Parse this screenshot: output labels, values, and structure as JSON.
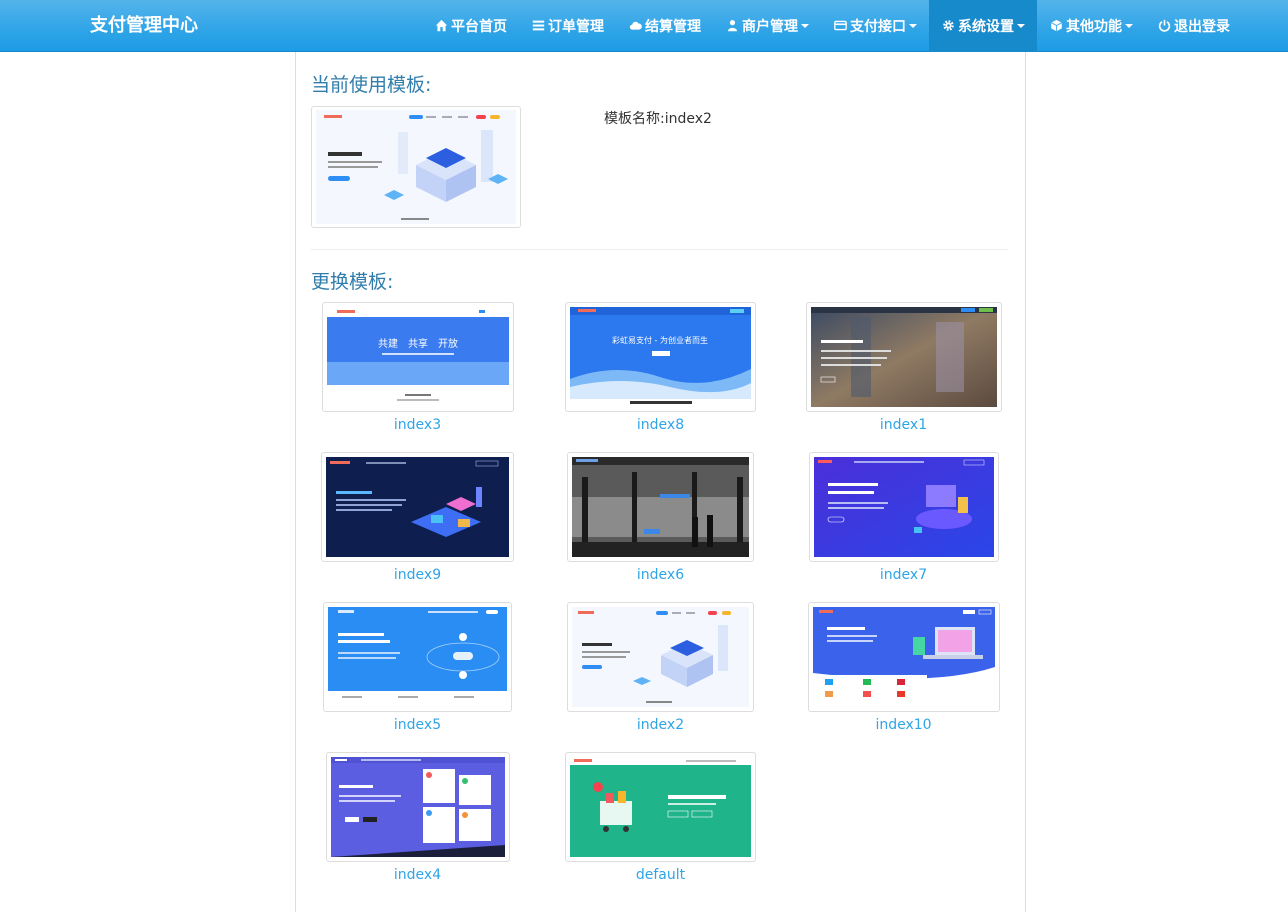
{
  "app": {
    "title": "支付管理中心"
  },
  "nav": [
    {
      "label": "平台首页",
      "icon": "home-icon"
    },
    {
      "label": "订单管理",
      "icon": "list-icon"
    },
    {
      "label": "结算管理",
      "icon": "cloud-icon"
    },
    {
      "label": "商户管理",
      "icon": "user-icon",
      "dropdown": true
    },
    {
      "label": "支付接口",
      "icon": "credit-card-icon",
      "dropdown": true
    },
    {
      "label": "系统设置",
      "icon": "gear-icon",
      "dropdown": true,
      "active": true
    },
    {
      "label": "其他功能",
      "icon": "cube-icon",
      "dropdown": true
    },
    {
      "label": "退出登录",
      "icon": "power-icon"
    }
  ],
  "current": {
    "heading": "当前使用模板:",
    "name_text": "模板名称:index2"
  },
  "change": {
    "heading": "更换模板:",
    "templates": [
      {
        "name": "index3"
      },
      {
        "name": "index8"
      },
      {
        "name": "index1"
      },
      {
        "name": "index9"
      },
      {
        "name": "index6"
      },
      {
        "name": "index7"
      },
      {
        "name": "index5"
      },
      {
        "name": "index2"
      },
      {
        "name": "index10"
      },
      {
        "name": "index4"
      },
      {
        "name": "default"
      }
    ]
  },
  "colors": {
    "navbar": "#2fa4e7",
    "navbar_active": "#178acc",
    "heading": "#317eac",
    "link": "#2fa4e7"
  }
}
